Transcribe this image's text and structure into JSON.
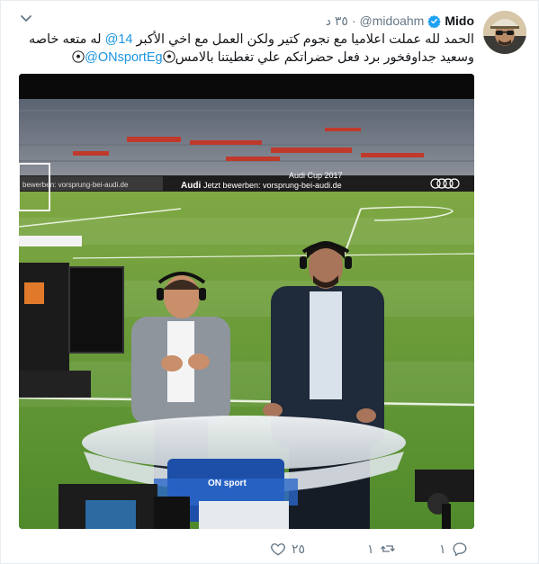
{
  "tweet": {
    "display_name": "Mido",
    "handle": "@midoahm",
    "separator": "·",
    "time": "٣٥ د",
    "text_part1": "الحمد لله عملت اعلاميا مع نجوم كتير ولكن العمل مع اخي الأكبر ",
    "mention1": "@14",
    "text_part2": " له متعه خاصه وسعيد جداوفخور برد فعل حضراتكم علي تغطيتنا بالامس",
    "mention2": "@ONsportEg",
    "media_overlay": {
      "banner_left": "Jetzt bewerben: vorsprung-bei-audi.de",
      "banner_brand": "Audi",
      "banner_cup": "Audi Cup 2017",
      "banner_small": "bewerben: vorsprung-bei-audi.de",
      "desk_logo": "ON sport"
    }
  },
  "actions": {
    "reply_count": "١",
    "retweet_count": "١",
    "like_count": "٢٥"
  },
  "colors": {
    "link": "#1b95e0",
    "muted": "#657786",
    "verified": "#1da1f2"
  }
}
